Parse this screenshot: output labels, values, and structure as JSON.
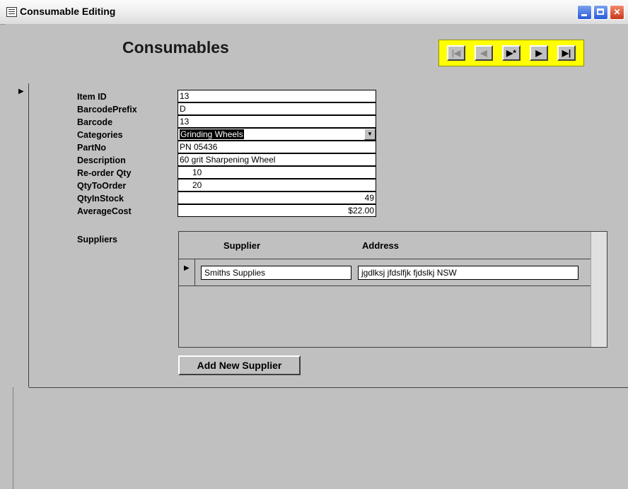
{
  "window": {
    "title": "Consumable Editing",
    "controls": {
      "minimize": "minimize",
      "maximize": "maximize",
      "close": "close"
    }
  },
  "header": {
    "form_title": "Consumables",
    "nav_buttons": {
      "first": "|◀",
      "previous": "◀",
      "new": "▶*",
      "next": "▶",
      "last": "▶|"
    },
    "nav_color": "#ffff00"
  },
  "fields": {
    "item_id": {
      "label": "Item ID",
      "value": "13"
    },
    "barcode_prefix": {
      "label": "BarcodePrefix",
      "value": "D"
    },
    "barcode": {
      "label": "Barcode",
      "value": "13"
    },
    "categories": {
      "label": "Categories",
      "value": "Grinding Wheels"
    },
    "part_no": {
      "label": "PartNo",
      "value": "PN 05436"
    },
    "description": {
      "label": "Description",
      "value": "60 grit Sharpening Wheel"
    },
    "reorder_qty": {
      "label": "Re-order Qty",
      "value": "10"
    },
    "qty_to_order": {
      "label": "QtyToOrder",
      "value": "20"
    },
    "qty_in_stock": {
      "label": "QtyInStock",
      "value": "49"
    },
    "average_cost": {
      "label": "AverageCost",
      "value": "$22.00"
    }
  },
  "suppliers": {
    "label": "Suppliers",
    "columns": [
      "Supplier",
      "Address"
    ],
    "rows": [
      {
        "supplier": "Smiths Supplies",
        "address": "jgdlksj jfdslfjk fjdslkj NSW"
      }
    ],
    "add_button": "Add New Supplier"
  }
}
